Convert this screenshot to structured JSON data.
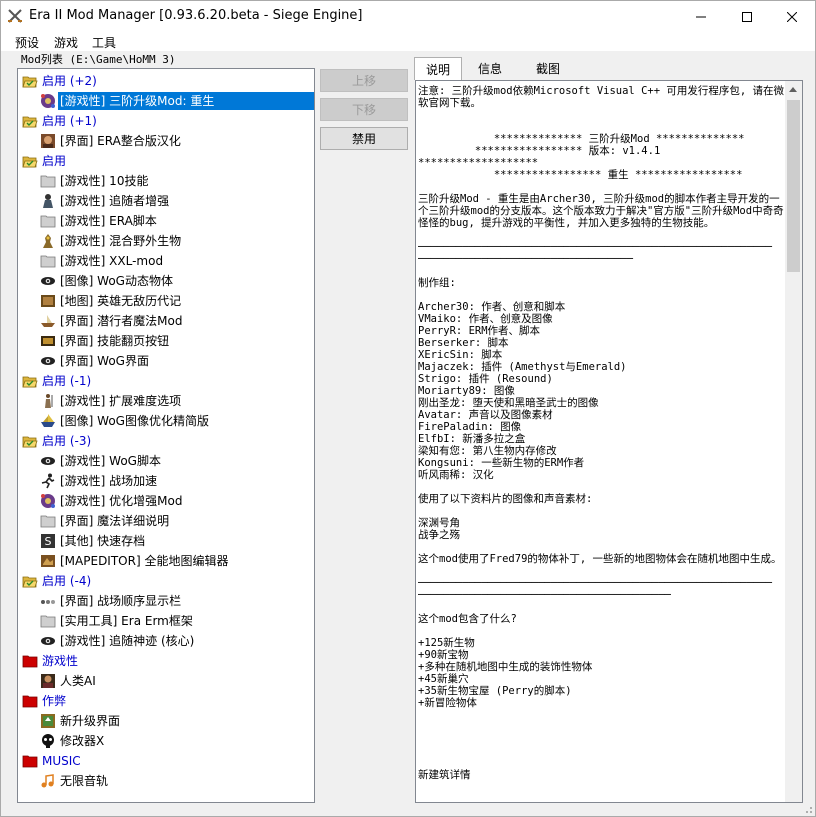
{
  "window": {
    "title": "Era II Mod Manager [0.93.6.20.beta - Siege Engine]"
  },
  "menu": [
    "预设",
    "游戏",
    "工具"
  ],
  "mod_list_label": "Mod列表 (E:\\Game\\HoMM 3)",
  "tree": [
    {
      "type": "group",
      "label": "启用 (+2)",
      "icon": "folder-open-icon"
    },
    {
      "type": "item",
      "label": "[游戏性] 三阶升级Mod: 重生",
      "icon": "mod-emblem-icon",
      "selected": true
    },
    {
      "type": "group",
      "label": "启用 (+1)",
      "icon": "folder-open-icon"
    },
    {
      "type": "item",
      "label": "[界面] ERA整合版汉化",
      "icon": "portrait-icon"
    },
    {
      "type": "group",
      "label": "启用",
      "icon": "folder-open-icon"
    },
    {
      "type": "item",
      "label": "[游戏性] 10技能",
      "icon": "folder-gray-icon"
    },
    {
      "type": "item",
      "label": "[游戏性] 追随者增强",
      "icon": "person-icon"
    },
    {
      "type": "item",
      "label": "[游戏性] ERA脚本",
      "icon": "folder-gray-icon"
    },
    {
      "type": "item",
      "label": "[游戏性] 混合野外生物",
      "icon": "creature-icon"
    },
    {
      "type": "item",
      "label": "[游戏性] XXL-mod",
      "icon": "folder-gray-icon"
    },
    {
      "type": "item",
      "label": "[图像] WoG动态物体",
      "icon": "eye-icon"
    },
    {
      "type": "item",
      "label": "[地图] 英雄无敌历代记",
      "icon": "map-icon"
    },
    {
      "type": "item",
      "label": "[界面] 潜行者魔法Mod",
      "icon": "boat-icon"
    },
    {
      "type": "item",
      "label": "[界面] 技能翻页按钮",
      "icon": "panel-icon"
    },
    {
      "type": "item",
      "label": "[界面] WoG界面",
      "icon": "eye-icon"
    },
    {
      "type": "group",
      "label": "启用 (-1)",
      "icon": "folder-open-icon"
    },
    {
      "type": "item",
      "label": "[游戏性] 扩展难度选项",
      "icon": "warrior-icon"
    },
    {
      "type": "item",
      "label": "[图像] WoG图像优化精简版",
      "icon": "ship-icon"
    },
    {
      "type": "group",
      "label": "启用 (-3)",
      "icon": "folder-open-icon"
    },
    {
      "type": "item",
      "label": "[游戏性] WoG脚本",
      "icon": "eye-icon"
    },
    {
      "type": "item",
      "label": "[游戏性] 战场加速",
      "icon": "runner-icon"
    },
    {
      "type": "item",
      "label": "[游戏性] 优化增强Mod",
      "icon": "mod-emblem-icon"
    },
    {
      "type": "item",
      "label": "[界面] 魔法详细说明",
      "icon": "folder-gray-icon"
    },
    {
      "type": "item",
      "label": "[其他] 快速存档",
      "icon": "save-s-icon"
    },
    {
      "type": "item",
      "label": "[MAPEDITOR] 全能地图编辑器",
      "icon": "map-editor-icon"
    },
    {
      "type": "group",
      "label": "启用 (-4)",
      "icon": "folder-open-icon"
    },
    {
      "type": "item",
      "label": "[界面] 战场顺序显示栏",
      "icon": "order-bar-icon"
    },
    {
      "type": "item",
      "label": "[实用工具] Era Erm框架",
      "icon": "folder-gray-icon"
    },
    {
      "type": "item",
      "label": "[游戏性] 追随神迹 (核心)",
      "icon": "eye-icon"
    },
    {
      "type": "group",
      "label": "游戏性",
      "icon": "folder-red-icon"
    },
    {
      "type": "item",
      "label": "人类AI",
      "icon": "ai-portrait-icon"
    },
    {
      "type": "group",
      "label": "作弊",
      "icon": "folder-red-icon"
    },
    {
      "type": "item",
      "label": "新升级界面",
      "icon": "upgrade-icon"
    },
    {
      "type": "item",
      "label": "修改器X",
      "icon": "skull-icon"
    },
    {
      "type": "group",
      "label": "MUSIC",
      "icon": "folder-red-icon"
    },
    {
      "type": "item",
      "label": "无限音轨",
      "icon": "music-icon"
    }
  ],
  "buttons": {
    "move_up": "上移",
    "move_down": "下移",
    "disable": "禁用"
  },
  "tabs": [
    "说明",
    "信息",
    "截图"
  ],
  "description": [
    "注意: 三阶升级mod依赖Microsoft Visual C++ 可用发行程序包, 请在微软官网下载。",
    "",
    "",
    "            ************** 三阶升级Mod **************",
    "         ***************** 版本: v1.4.1",
    "*******************",
    "            ***************** 重生 *****************",
    "",
    "三阶升级Mod - 重生是由Archer30, 三阶升级mod的脚本作者主导开发的一个三阶升级mod的分支版本。这个版本致力于解决\"官方版\"三阶升级Mod中奇奇怪怪的bug, 提升游戏的平衡性, 并加入更多独特的生物技能。",
    "",
    "────────────────────────────────────────────────────────",
    "──────────────────────────────────",
    "",
    "制作组:",
    "",
    "Archer30: 作者、创意和脚本",
    "VMaiko: 作者、创意及图像",
    "PerryR: ERM作者、脚本",
    "Berserker: 脚本",
    "XEricSin: 脚本",
    "Majaczek: 插件 (Amethyst与Emerald)",
    "Strigo: 插件 (Resound)",
    "Moriarty89: 图像",
    "刚出圣龙: 堕天使和黑暗圣武士的图像",
    "Avatar: 声音以及图像素材",
    "FirePaladin: 图像",
    "ElfbI: 新潘多拉之盒",
    "梁知有您: 第八生物内存修改",
    "Kongsuni: 一些新生物的ERM作者",
    "听风雨稀: 汉化",
    "",
    "使用了以下资料片的图像和声音素材:",
    "",
    "深渊号角",
    "战争之殇",
    "",
    "这个mod使用了Fred79的物体补丁, 一些新的地图物体会在随机地图中生成。",
    "",
    "────────────────────────────────────────────────────────",
    "────────────────────────────────────────",
    "",
    "这个mod包含了什么?",
    "",
    "+125新生物",
    "+90新宝物",
    "+多种在随机地图中生成的装饰性物体",
    "+45新巢穴",
    "+35新生物宝屋 (Perry的脚本)",
    "+新冒险物体",
    "",
    "",
    "",
    "",
    "",
    "新建筑详情"
  ],
  "colors": {
    "group_text": "#0000cc",
    "selection": "#0078d7",
    "folder_open": "#dcb53d",
    "folder_red": "#cc0000"
  }
}
